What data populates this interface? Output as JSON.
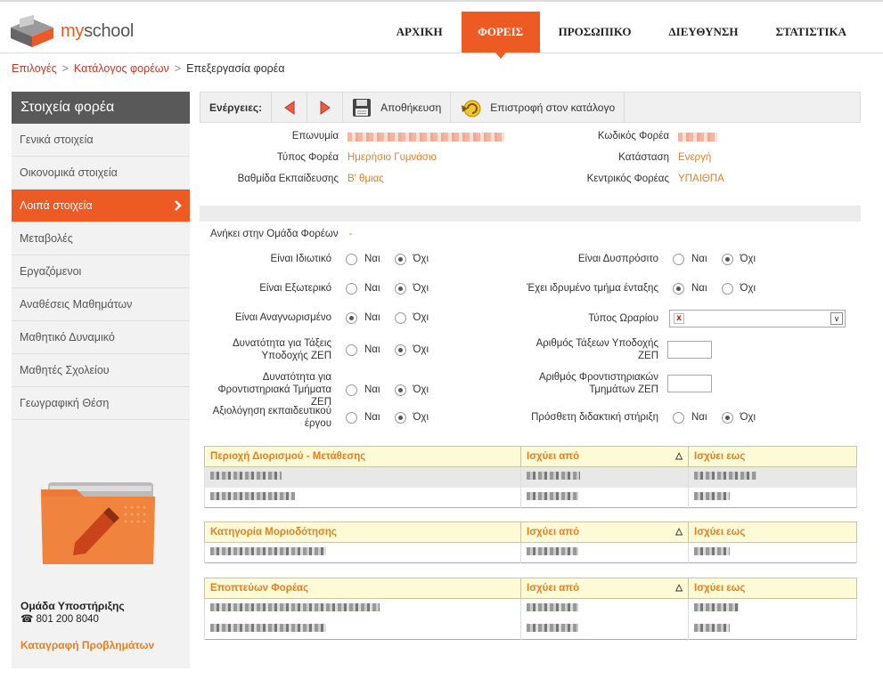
{
  "brand": {
    "name_prefix": "my",
    "name_suffix": "school"
  },
  "nav": [
    {
      "label": "ΑΡΧΙΚΗ",
      "active": false
    },
    {
      "label": "ΦΟΡΕΙΣ",
      "active": true
    },
    {
      "label": "ΠΡΟΣΩΠΙΚΟ",
      "active": false
    },
    {
      "label": "ΔΙΕΥΘΥΝΣΗ",
      "active": false
    },
    {
      "label": "ΣΤΑΤΙΣΤΙΚΑ",
      "active": false
    }
  ],
  "breadcrumb": {
    "item1": "Επιλογές",
    "item2": "Κατάλογος φορέων",
    "current": "Επεξεργασία φορέα",
    "sep": ">"
  },
  "sidebar": {
    "title": "Στοιχεία φορέα",
    "items": [
      {
        "label": "Γενικά στοιχεία"
      },
      {
        "label": "Οικονομικά στοιχεία"
      },
      {
        "label": "Λοιπά στοιχεία"
      },
      {
        "label": "Μεταβολές"
      },
      {
        "label": "Εργαζόμενοι"
      },
      {
        "label": "Αναθέσεις Μαθημάτων"
      },
      {
        "label": "Μαθητικό Δυναμικό"
      },
      {
        "label": "Μαθητές Σχολείου"
      },
      {
        "label": "Γεωγραφική Θέση"
      }
    ],
    "support_title": "Ομάδα Υποστήριξης",
    "support_phone": "801 200 8040",
    "report_link": "Καταγραφή Προβλημάτων"
  },
  "actions": {
    "label": "Ενέργειες:",
    "save": "Αποθήκευση",
    "back": "Επιστροφή στον κατάλογο"
  },
  "info": {
    "name_label": "Επωνυμία",
    "type_label": "Τύπος Φορέα",
    "type_value": "Ημερήσιο Γυμνάσιο",
    "level_label": "Βαθμίδα Εκπαίδευσης",
    "level_value": "Β' θμιας",
    "code_label": "Κωδικός Φορέα",
    "status_label": "Κατάσταση",
    "status_value": "Ενεργή",
    "central_label": "Κεντρικός Φορέας",
    "central_value": "ΥΠΑΙΘΠΑ"
  },
  "form": {
    "group_label": "Ανήκει στην Ομάδα Φορέων",
    "group_value": "-",
    "yes": "Ναι",
    "no": "Όχι",
    "private": "Είναι Ιδιωτικό",
    "external": "Είναι Εξωτερικό",
    "recognized": "Είναι Αναγνωρισμένο",
    "zep_classes": "Δυνατότητα για Τάξεις Υποδοχής ΖΕΠ",
    "zep_tutoring": "Δυνατότητα για Φροντιστηριακά Τμήματα ΖΕΠ",
    "evaluation": "Αξιολόγηση εκπαιδευτικού έργου",
    "remote": "Είναι Δυσπρόσιτο",
    "integration": "Έχει ιδρυμένο τμήμα ένταξης",
    "schedule_type": "Τύπος Ωραρίου",
    "zep_class_count": "Αριθμός Τάξεων Υποδοχής ΖΕΠ",
    "zep_tutoring_count": "Αριθμός Φροντιστηριακών Τμημάτων ΖΕΠ",
    "extra_support": "Πρόσθετη διδακτική στήριξη"
  },
  "tables": [
    {
      "col1": "Περιοχή Διορισμού - Μετάθεσης",
      "col2": "Ισχύει από",
      "col3": "Ισχύει εως"
    },
    {
      "col1": "Κατηγορία Μοριοδότησης",
      "col2": "Ισχύει από",
      "col3": "Ισχύει εως"
    },
    {
      "col1": "Εποπτεύων Φορέας",
      "col2": "Ισχύει από",
      "col3": "Ισχύει εως"
    }
  ],
  "sort_indicator": "△"
}
